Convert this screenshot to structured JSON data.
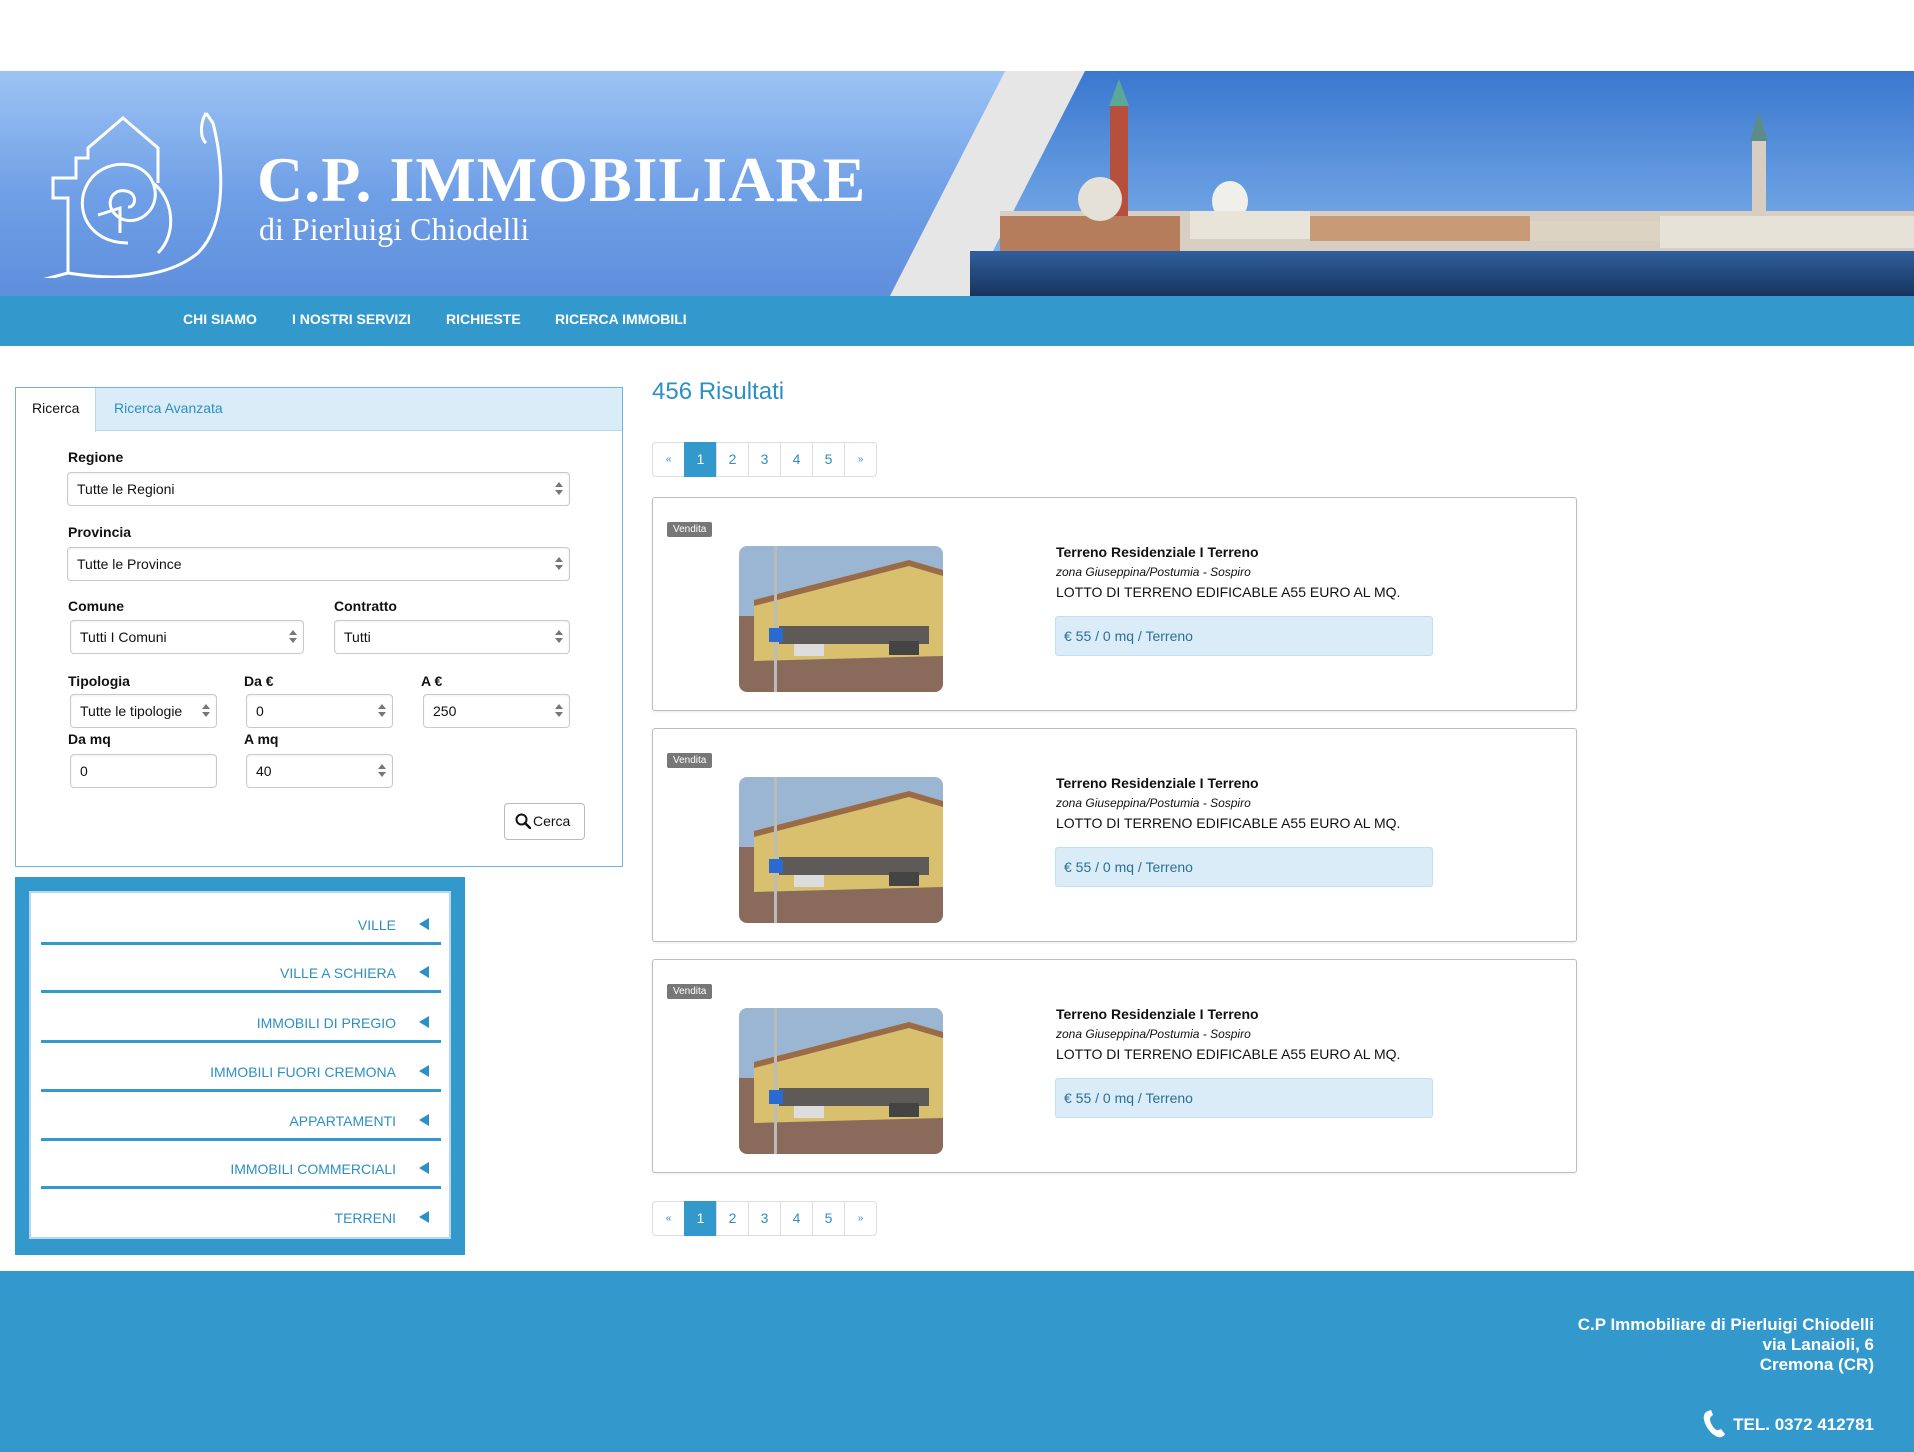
{
  "header": {
    "brand_title": "C.P. IMMOBILIARE",
    "brand_subtitle": "di Pierluigi Chiodelli"
  },
  "nav": {
    "items": [
      "CHI SIAMO",
      "I NOSTRI SERVIZI",
      "RICHIESTE",
      "RICERCA IMMOBILI"
    ]
  },
  "search": {
    "tabs": [
      "Ricerca",
      "Ricerca Avanzata"
    ],
    "regione_label": "Regione",
    "regione_value": "Tutte le Regioni",
    "provincia_label": "Provincia",
    "provincia_value": "Tutte le Province",
    "comune_label": "Comune",
    "comune_value": "Tutti I Comuni",
    "contratto_label": "Contratto",
    "contratto_value": "Tutti",
    "tipologia_label": "Tipologia",
    "tipologia_value": "Tutte le tipologie",
    "da_eur_label": "Da €",
    "da_eur_value": "0",
    "a_eur_label": "A €",
    "a_eur_value": "250",
    "da_mq_label": "Da mq",
    "da_mq_value": "0",
    "a_mq_label": "A mq",
    "a_mq_value": "40",
    "button_label": "Cerca"
  },
  "categories": [
    "VILLE",
    "VILLE A SCHIERA",
    "IMMOBILI DI PREGIO",
    "IMMOBILI FUORI CREMONA",
    "APPARTAMENTI",
    "IMMOBILI COMMERCIALI",
    "TERRENI"
  ],
  "results": {
    "title": "456 Risultati",
    "pagination": {
      "first": "«",
      "pages": [
        "1",
        "2",
        "3",
        "4",
        "5"
      ],
      "last": "»",
      "active": "1"
    },
    "listings": [
      {
        "badge": "Vendita",
        "title": "Terreno Residenziale I Terreno",
        "zone": "zona Giuseppina/Postumia - Sospiro",
        "description": "LOTTO DI TERRENO EDIFICABLE A55 EURO AL MQ.",
        "price": "€ 55 / 0 mq / Terreno"
      },
      {
        "badge": "Vendita",
        "title": "Terreno Residenziale I Terreno",
        "zone": "zona Giuseppina/Postumia - Sospiro",
        "description": "LOTTO DI TERRENO EDIFICABLE A55 EURO AL MQ.",
        "price": "€ 55 / 0 mq / Terreno"
      },
      {
        "badge": "Vendita",
        "title": "Terreno Residenziale I Terreno",
        "zone": "zona Giuseppina/Postumia - Sospiro",
        "description": "LOTTO DI TERRENO EDIFICABLE A55 EURO AL MQ.",
        "price": "€ 55 / 0 mq / Terreno"
      }
    ]
  },
  "footer": {
    "company": "C.P Immobiliare di Pierluigi Chiodelli",
    "address": "via Lanaioli, 6",
    "city": "Cremona (CR)",
    "phone": "TEL. 0372 412781",
    "phone_icon": "phone-icon"
  },
  "colors": {
    "accent": "#3399cc",
    "link": "#2d8fc4",
    "header_gradient_top": "#9cc3f3",
    "header_gradient_bottom": "#5f8fdc"
  }
}
